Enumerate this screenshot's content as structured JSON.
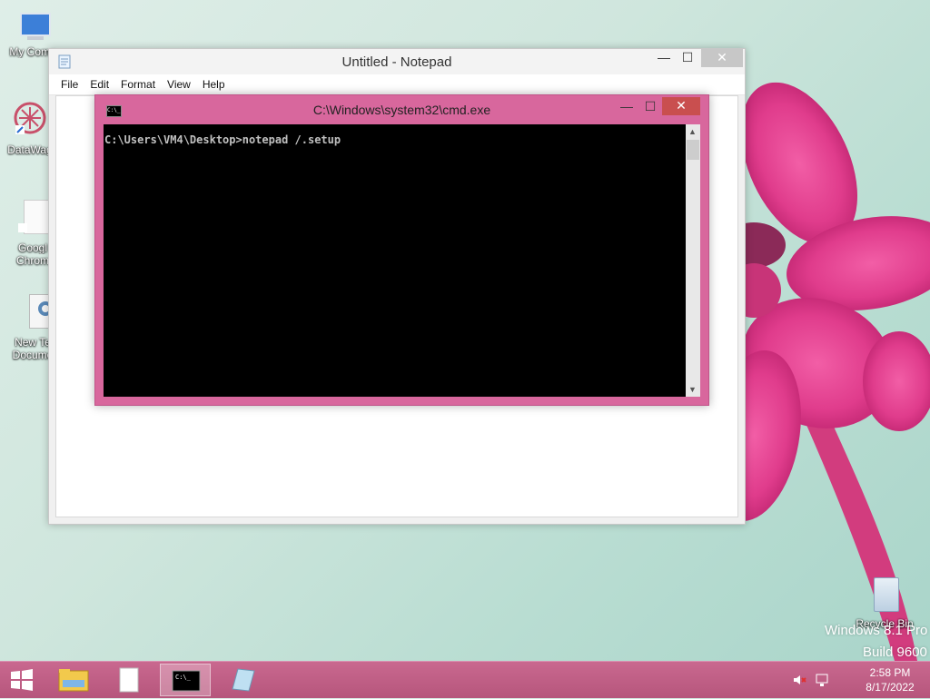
{
  "desktop": {
    "icons": [
      {
        "name": "My Computer",
        "label": "My Comp",
        "icon": "computer-icon"
      },
      {
        "name": "DataWagon",
        "label": "DataWag",
        "icon": "datawagon-icon"
      },
      {
        "name": "Google Chrome",
        "label_line1": "Googl",
        "label_line2": "Chrom",
        "icon": "chrome-shortcut-icon"
      },
      {
        "name": "New Text Document",
        "label_line1": "New Te",
        "label_line2": "Docume",
        "icon": "settings-document-icon"
      },
      {
        "name": "Recycle Bin",
        "label": "Recycle Bin",
        "icon": "recycle-bin-icon"
      }
    ],
    "watermark_line1": "Windows 8.1 Pro",
    "watermark_line2": "Build 9600"
  },
  "notepad": {
    "title": "Untitled - Notepad",
    "menu": [
      "File",
      "Edit",
      "Format",
      "View",
      "Help"
    ],
    "controls": {
      "minimize": "—",
      "maximize": "☐",
      "close": "✕"
    }
  },
  "cmd": {
    "title": "C:\\Windows\\system32\\cmd.exe",
    "icon_text": "C:\\_",
    "console_text": "C:\\Users\\VM4\\Desktop>notepad /.setup",
    "controls": {
      "minimize": "—",
      "maximize": "☐",
      "close": "✕"
    },
    "accent_color": "#d8679d"
  },
  "taskbar": {
    "items": [
      "start-button",
      "file-explorer",
      "blank-document",
      "command-prompt",
      "notepad"
    ],
    "active_item": "command-prompt",
    "time": "2:58 PM",
    "date": "8/17/2022",
    "color": "#c0608a"
  }
}
